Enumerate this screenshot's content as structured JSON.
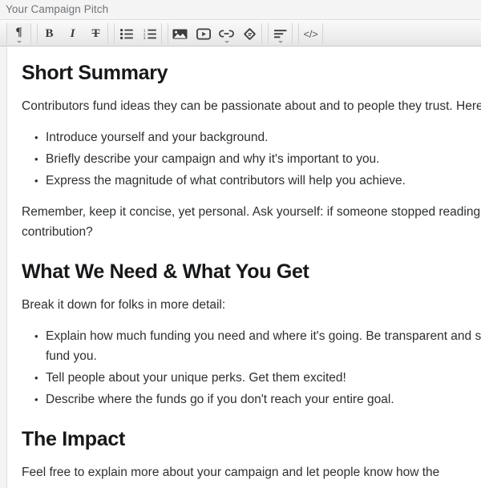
{
  "field": {
    "label": "Your Campaign Pitch"
  },
  "toolbar": {
    "groups": [
      {
        "name": "paragraph-format",
        "buttons": [
          {
            "name": "paragraph-format-button",
            "icon": "paragraph-icon",
            "glyph": "¶",
            "has_caret": true
          }
        ]
      },
      {
        "name": "text-style",
        "buttons": [
          {
            "name": "bold-button",
            "icon": "bold-icon",
            "glyph": "B",
            "has_caret": false
          },
          {
            "name": "italic-button",
            "icon": "italic-icon",
            "glyph": "I",
            "has_caret": false
          },
          {
            "name": "strikethrough-button",
            "icon": "strikethrough-icon",
            "glyph": "T",
            "has_caret": false
          }
        ]
      },
      {
        "name": "lists",
        "buttons": [
          {
            "name": "unordered-list-button",
            "icon": "bullet-list-icon",
            "has_caret": false
          },
          {
            "name": "ordered-list-button",
            "icon": "numbered-list-icon",
            "has_caret": false
          }
        ]
      },
      {
        "name": "media",
        "buttons": [
          {
            "name": "insert-image-button",
            "icon": "image-icon",
            "has_caret": false
          },
          {
            "name": "insert-video-button",
            "icon": "video-icon",
            "has_caret": false
          },
          {
            "name": "insert-link-button",
            "icon": "link-icon",
            "has_caret": true
          },
          {
            "name": "insert-embed-button",
            "icon": "diamond-embed-icon",
            "has_caret": false
          }
        ]
      },
      {
        "name": "alignment",
        "buttons": [
          {
            "name": "align-button",
            "icon": "align-left-icon",
            "has_caret": true
          }
        ]
      },
      {
        "name": "source",
        "buttons": [
          {
            "name": "html-source-button",
            "icon": "code-icon",
            "glyph": "</>",
            "has_caret": false
          }
        ]
      }
    ]
  },
  "document": {
    "blocks": [
      {
        "type": "heading",
        "name": "heading-short-summary",
        "text": "Short Summary"
      },
      {
        "type": "paragraph",
        "name": "paragraph-contributors",
        "text": "Contributors fund ideas they can be passionate about and to people they trust. Here are some things to do in this section:"
      },
      {
        "type": "list",
        "name": "list-short-summary",
        "items": [
          "Introduce yourself and your background.",
          "Briefly describe your campaign and why it's important to you.",
          "Express the magnitude of what contributors will help you achieve."
        ]
      },
      {
        "type": "paragraph",
        "name": "paragraph-remember",
        "text": "Remember, keep it concise, yet personal. Ask yourself: if someone stopped reading here would they be ready to make a contribution?"
      },
      {
        "type": "heading",
        "name": "heading-what-we-need",
        "text": "What We Need & What You Get"
      },
      {
        "type": "paragraph",
        "name": "paragraph-break-it-down",
        "text": "Break it down for folks in more detail:"
      },
      {
        "type": "list",
        "name": "list-what-we-need",
        "items": [
          "Explain how much funding you need and where it's going. Be transparent and specific-people need to trust you to want to fund you.",
          "Tell people about your unique perks. Get them excited!",
          "Describe where the funds go if you don't reach your entire goal."
        ]
      },
      {
        "type": "heading",
        "name": "heading-the-impact",
        "text": "The Impact"
      },
      {
        "type": "paragraph",
        "name": "paragraph-feel-free",
        "text": "Feel free to explain more about your campaign and let people know how the"
      }
    ]
  },
  "colors": {
    "page_background": "#f4f4f4",
    "editor_background": "#ffffff",
    "label_text": "#6f7276",
    "body_text": "#2d2f31",
    "heading_text": "#17181a",
    "toolbar_border": "#c9c9c9"
  }
}
